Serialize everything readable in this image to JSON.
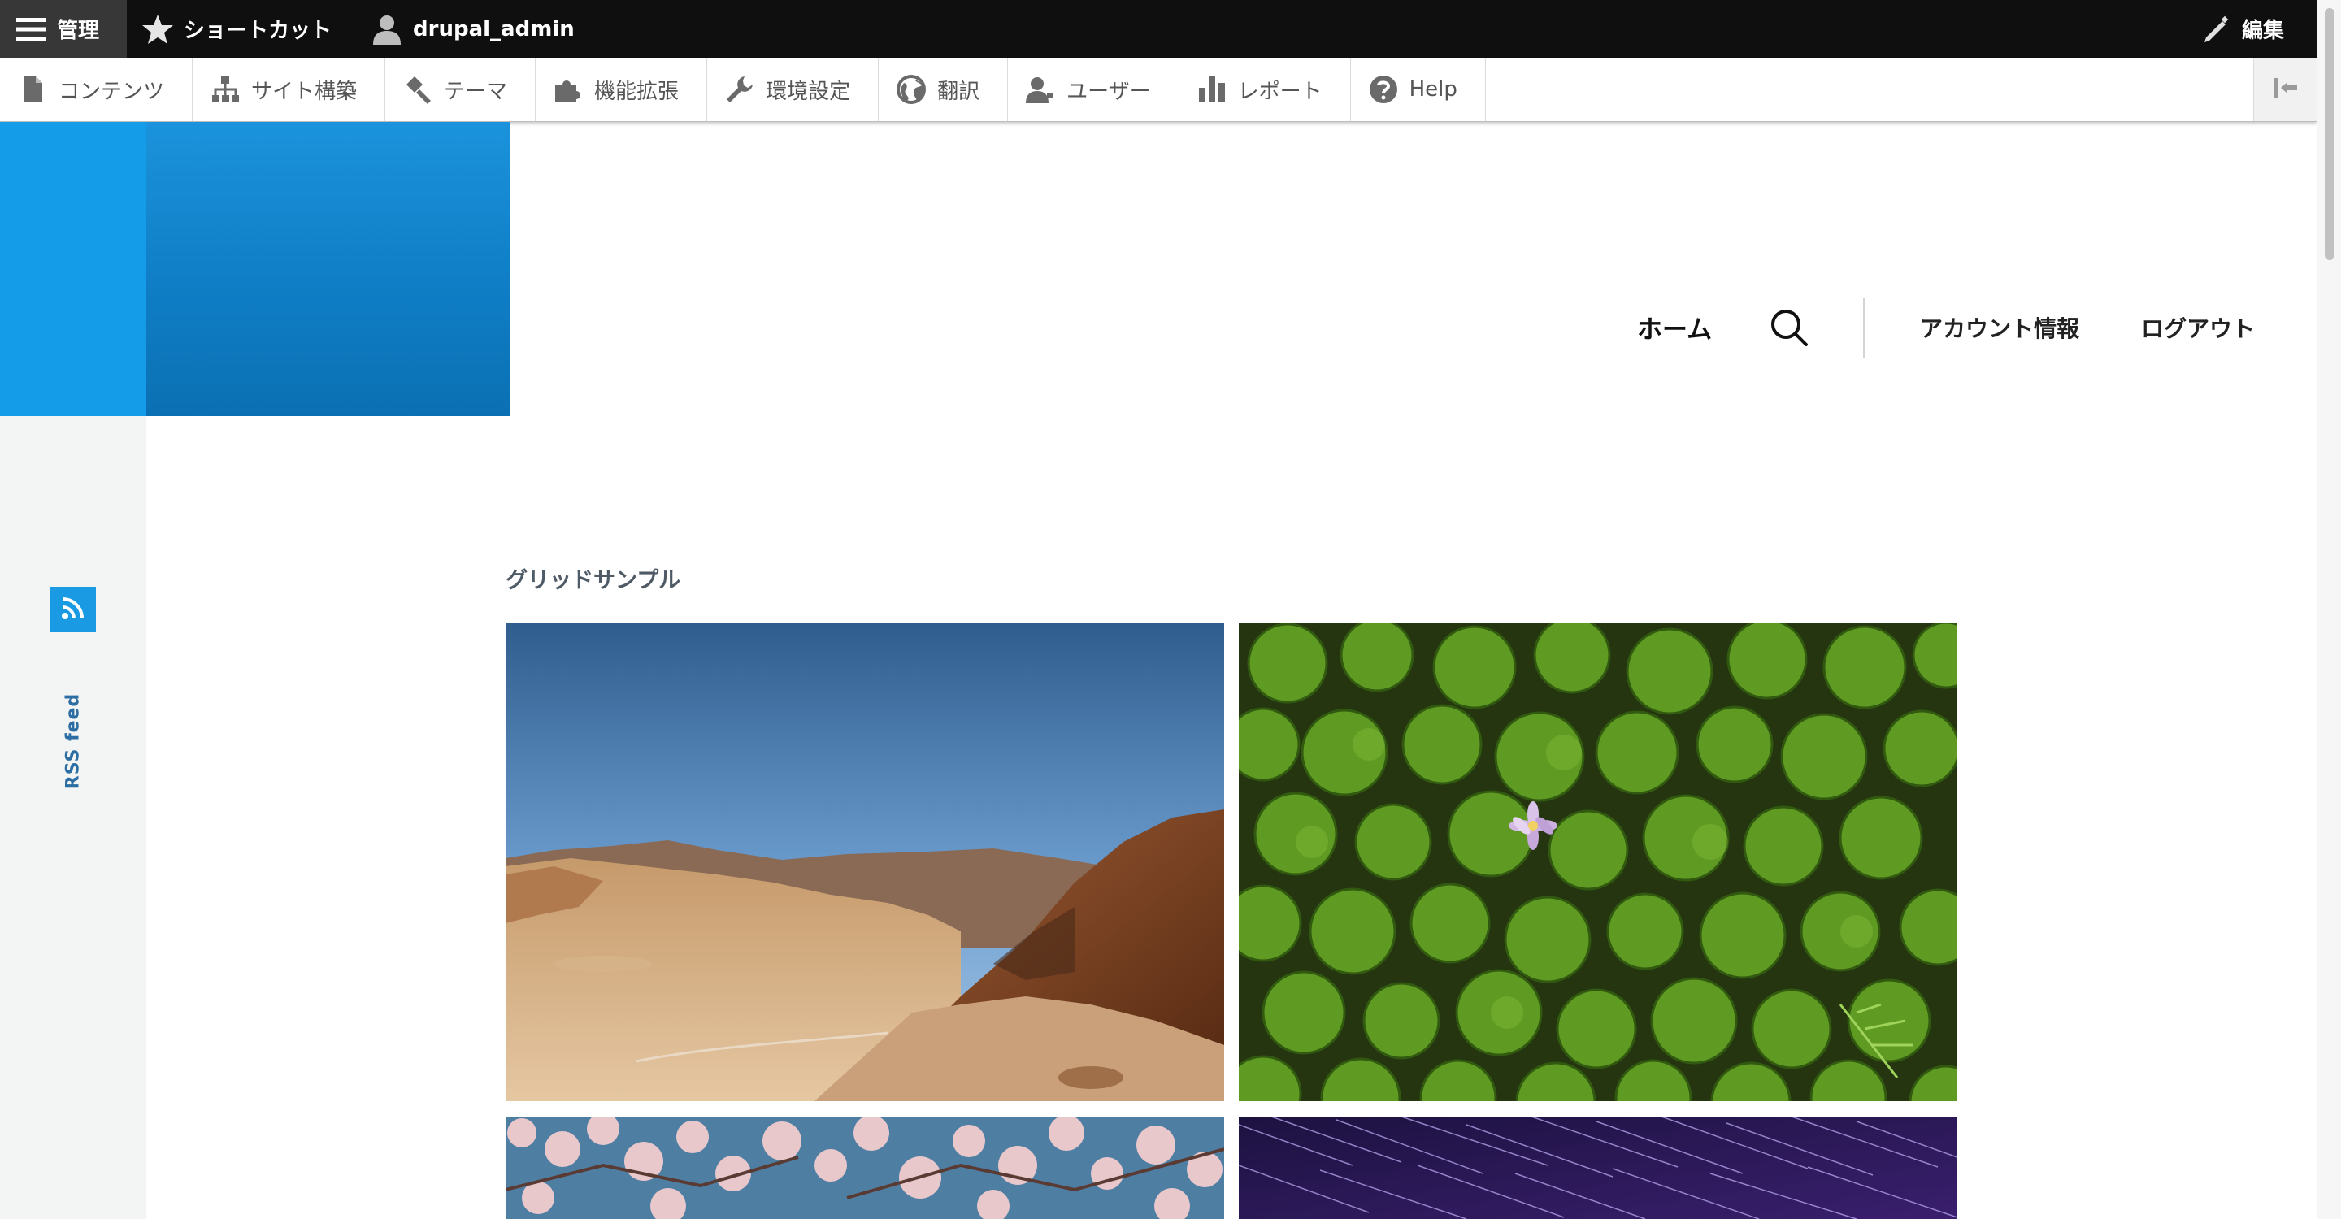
{
  "toolbar": {
    "manage_label": "管理",
    "shortcuts_label": "ショートカット",
    "user_label": "drupal_admin",
    "edit_label": "編集"
  },
  "tray": {
    "items": [
      {
        "label": "コンテンツ",
        "icon": "file-icon"
      },
      {
        "label": "サイト構築",
        "icon": "sitemap-icon"
      },
      {
        "label": "テーマ",
        "icon": "paintbrush-icon"
      },
      {
        "label": "機能拡張",
        "icon": "puzzle-icon"
      },
      {
        "label": "環境設定",
        "icon": "wrench-icon"
      },
      {
        "label": "翻訳",
        "icon": "globe-icon"
      },
      {
        "label": "ユーザー",
        "icon": "people-icon"
      },
      {
        "label": "レポート",
        "icon": "bar-chart-icon"
      },
      {
        "label": "Help",
        "icon": "help-icon"
      }
    ]
  },
  "nav": {
    "home": "ホーム",
    "account": "アカウント情報",
    "logout": "ログアウト"
  },
  "social": {
    "rss_label": "RSS feed"
  },
  "content": {
    "section_title": "グリッドサンプル"
  },
  "colors": {
    "toolbar_bg": "#0f0f0f",
    "logo_blue": "#149ce8",
    "logo_gradient_dark": "#0b70b3",
    "rss_blue": "#1b9ae4",
    "section_title": "#4e5a66"
  }
}
